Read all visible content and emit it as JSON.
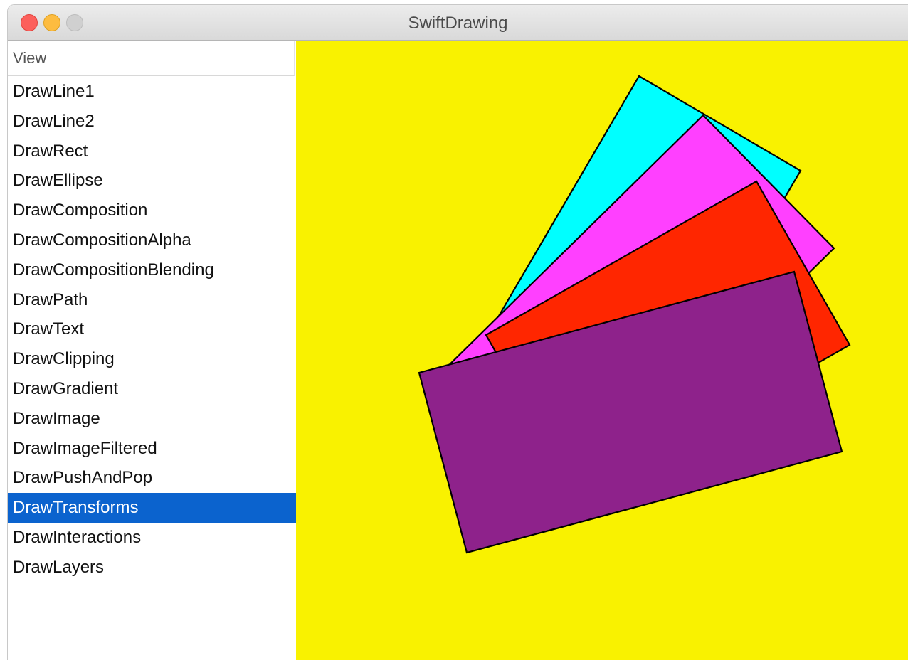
{
  "window": {
    "title": "SwiftDrawing"
  },
  "sidebar": {
    "header": "View",
    "items": [
      {
        "label": "DrawLine1",
        "selected": false
      },
      {
        "label": "DrawLine2",
        "selected": false
      },
      {
        "label": "DrawRect",
        "selected": false
      },
      {
        "label": "DrawEllipse",
        "selected": false
      },
      {
        "label": "DrawComposition",
        "selected": false
      },
      {
        "label": "DrawCompositionAlpha",
        "selected": false
      },
      {
        "label": "DrawCompositionBlending",
        "selected": false
      },
      {
        "label": "DrawPath",
        "selected": false
      },
      {
        "label": "DrawText",
        "selected": false
      },
      {
        "label": "DrawClipping",
        "selected": false
      },
      {
        "label": "DrawGradient",
        "selected": false
      },
      {
        "label": "DrawImage",
        "selected": false
      },
      {
        "label": "DrawImageFiltered",
        "selected": false
      },
      {
        "label": "DrawPushAndPop",
        "selected": false
      },
      {
        "label": "DrawTransforms",
        "selected": true
      },
      {
        "label": "DrawInteractions",
        "selected": false
      },
      {
        "label": "DrawLayers",
        "selected": false
      }
    ]
  },
  "canvas": {
    "background_color": "#f9f200",
    "rectangle_colors": [
      "#00ffff",
      "#ff40ff",
      "#ff2600",
      "#8e228b"
    ],
    "stroke_color": "#000000",
    "accent_color": "#0b63ce"
  }
}
